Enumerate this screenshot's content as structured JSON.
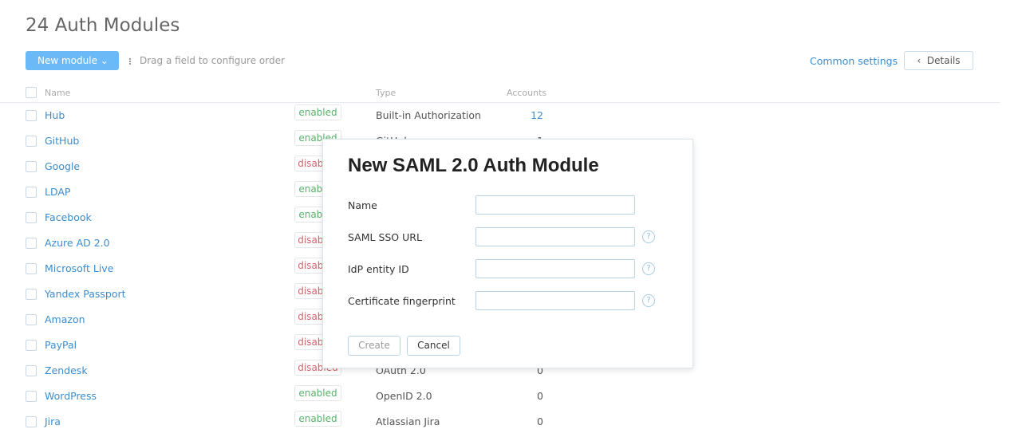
{
  "page_title": "24 Auth Modules",
  "toolbar": {
    "new_module": "New module",
    "drag_hint": "Drag a field to configure order",
    "common_settings": "Common settings",
    "details": "Details"
  },
  "columns": {
    "name": "Name",
    "type": "Type",
    "accounts": "Accounts"
  },
  "rows": [
    {
      "name": "Hub",
      "status": "enabled",
      "type": "Built-in Authorization",
      "accounts": "12"
    },
    {
      "name": "GitHub",
      "status": "enabled",
      "type": "GitHub",
      "accounts": "1"
    },
    {
      "name": "Google",
      "status": "disabled",
      "type": "",
      "accounts": ""
    },
    {
      "name": "LDAP",
      "status": "enabled",
      "type": "",
      "accounts": ""
    },
    {
      "name": "Facebook",
      "status": "enabled",
      "type": "",
      "accounts": ""
    },
    {
      "name": "Azure AD 2.0",
      "status": "disabled",
      "type": "",
      "accounts": ""
    },
    {
      "name": "Microsoft Live",
      "status": "disabled",
      "type": "",
      "accounts": ""
    },
    {
      "name": "Yandex Passport",
      "status": "disabled",
      "type": "",
      "accounts": ""
    },
    {
      "name": "Amazon",
      "status": "disabled",
      "type": "",
      "accounts": ""
    },
    {
      "name": "PayPal",
      "status": "disabled",
      "type": "",
      "accounts": ""
    },
    {
      "name": "Zendesk",
      "status": "disabled",
      "type": "OAuth 2.0",
      "accounts": "0"
    },
    {
      "name": "WordPress",
      "status": "enabled",
      "type": "OpenID 2.0",
      "accounts": "0"
    },
    {
      "name": "Jira",
      "status": "enabled",
      "type": "Atlassian Jira",
      "accounts": "0"
    }
  ],
  "modal": {
    "title": "New SAML 2.0 Auth Module",
    "fields": [
      {
        "label": "Name",
        "value": "",
        "help": false
      },
      {
        "label": "SAML SSO URL",
        "value": "",
        "help": true
      },
      {
        "label": "IdP entity ID",
        "value": "",
        "help": true
      },
      {
        "label": "Certificate fingerprint",
        "value": "",
        "help": true
      }
    ],
    "create": "Create",
    "cancel": "Cancel"
  }
}
